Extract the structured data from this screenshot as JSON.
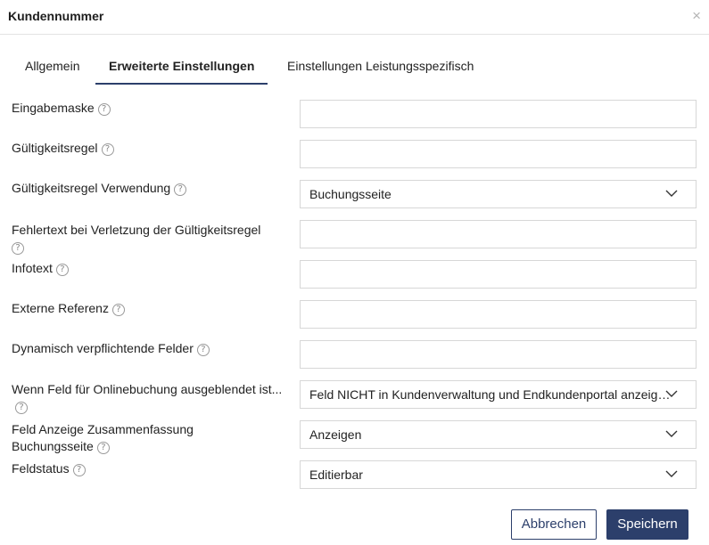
{
  "dialog": {
    "title": "Kundennummer",
    "close_glyph": "×"
  },
  "tabs": [
    {
      "label": "Allgemein",
      "active": false
    },
    {
      "label": "Erweiterte Einstellungen",
      "active": true
    },
    {
      "label": "Einstellungen Leistungsspezifisch",
      "active": false
    }
  ],
  "help_glyph": "?",
  "fields": {
    "eingabemaske": {
      "label": "Eingabemaske",
      "value": ""
    },
    "gueltigkeitsregel": {
      "label": "Gültigkeitsregel",
      "value": ""
    },
    "gueltigkeitsregel_verwendung": {
      "label": "Gültigkeitsregel Verwendung",
      "value": "Buchungsseite"
    },
    "fehlertext": {
      "label": "Fehlertext bei Verletzung der Gültigkeitsregel",
      "value": ""
    },
    "infotext": {
      "label": "Infotext",
      "value": ""
    },
    "externe_referenz": {
      "label": "Externe Referenz",
      "value": ""
    },
    "dynamisch": {
      "label": "Dynamisch verpflichtende Felder",
      "value": ""
    },
    "ausgeblendet": {
      "label": "Wenn Feld für Onlinebuchung ausgeblendet ist...",
      "value": "Feld NICHT in Kundenverwaltung und Endkundenportal anzeigen"
    },
    "zusammenfassung": {
      "label": "Feld Anzeige Zusammenfassung Buchungsseite",
      "value": "Anzeigen"
    },
    "feldstatus": {
      "label": "Feldstatus",
      "value": "Editierbar"
    }
  },
  "buttons": {
    "cancel": "Abbrechen",
    "save": "Speichern"
  },
  "colors": {
    "primary": "#2c3f6b",
    "border": "#d7d7d7",
    "help_icon": "#9a9a9a"
  },
  "icons": {
    "help": "help-circle-icon",
    "dropdown": "chevron-down-icon",
    "close": "close-icon"
  }
}
